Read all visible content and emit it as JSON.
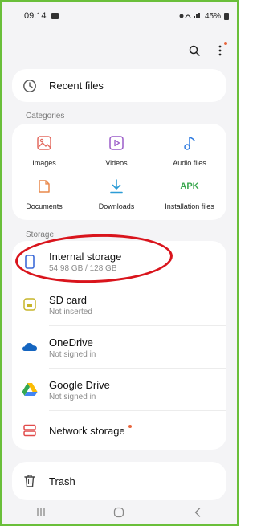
{
  "status_bar": {
    "time": "09:14",
    "battery": "45%"
  },
  "toolbar": {
    "search_icon": "search-icon",
    "more_icon": "more-vertical-icon"
  },
  "recent": {
    "label": "Recent files"
  },
  "categories": {
    "header": "Categories",
    "items": [
      {
        "label": "Images",
        "icon": "image-icon",
        "color": "#e36b60"
      },
      {
        "label": "Videos",
        "icon": "video-icon",
        "color": "#9a5bc8"
      },
      {
        "label": "Audio files",
        "icon": "music-note-icon",
        "color": "#2f7be0"
      },
      {
        "label": "Documents",
        "icon": "document-icon",
        "color": "#e9884b"
      },
      {
        "label": "Downloads",
        "icon": "download-icon",
        "color": "#2c9cd6"
      },
      {
        "label": "Installation files",
        "icon": "apk-icon",
        "badge": "APK",
        "color": "#3aa84f"
      }
    ]
  },
  "storage": {
    "header": "Storage",
    "items": [
      {
        "title": "Internal storage",
        "subtitle": "54.98 GB / 128 GB",
        "icon": "phone-icon",
        "color": "#3d6bd8"
      },
      {
        "title": "SD card",
        "subtitle": "Not inserted",
        "icon": "sd-card-icon",
        "color": "#c7b52a"
      },
      {
        "title": "OneDrive",
        "subtitle": "Not signed in",
        "icon": "onedrive-icon",
        "color": "#1565c0"
      },
      {
        "title": "Google Drive",
        "subtitle": "Not signed in",
        "icon": "google-drive-icon",
        "color": "#34a853"
      },
      {
        "title": "Network storage",
        "subtitle": "",
        "icon": "network-storage-icon",
        "color": "#e14b4b"
      }
    ]
  },
  "trash": {
    "label": "Trash"
  },
  "navigation": {
    "recents": "recents-icon",
    "home": "home-icon",
    "back": "back-icon"
  },
  "colors": {
    "frame_border": "#6abf3a",
    "annotation": "#d9141c",
    "new_dot": "#e8663d"
  }
}
